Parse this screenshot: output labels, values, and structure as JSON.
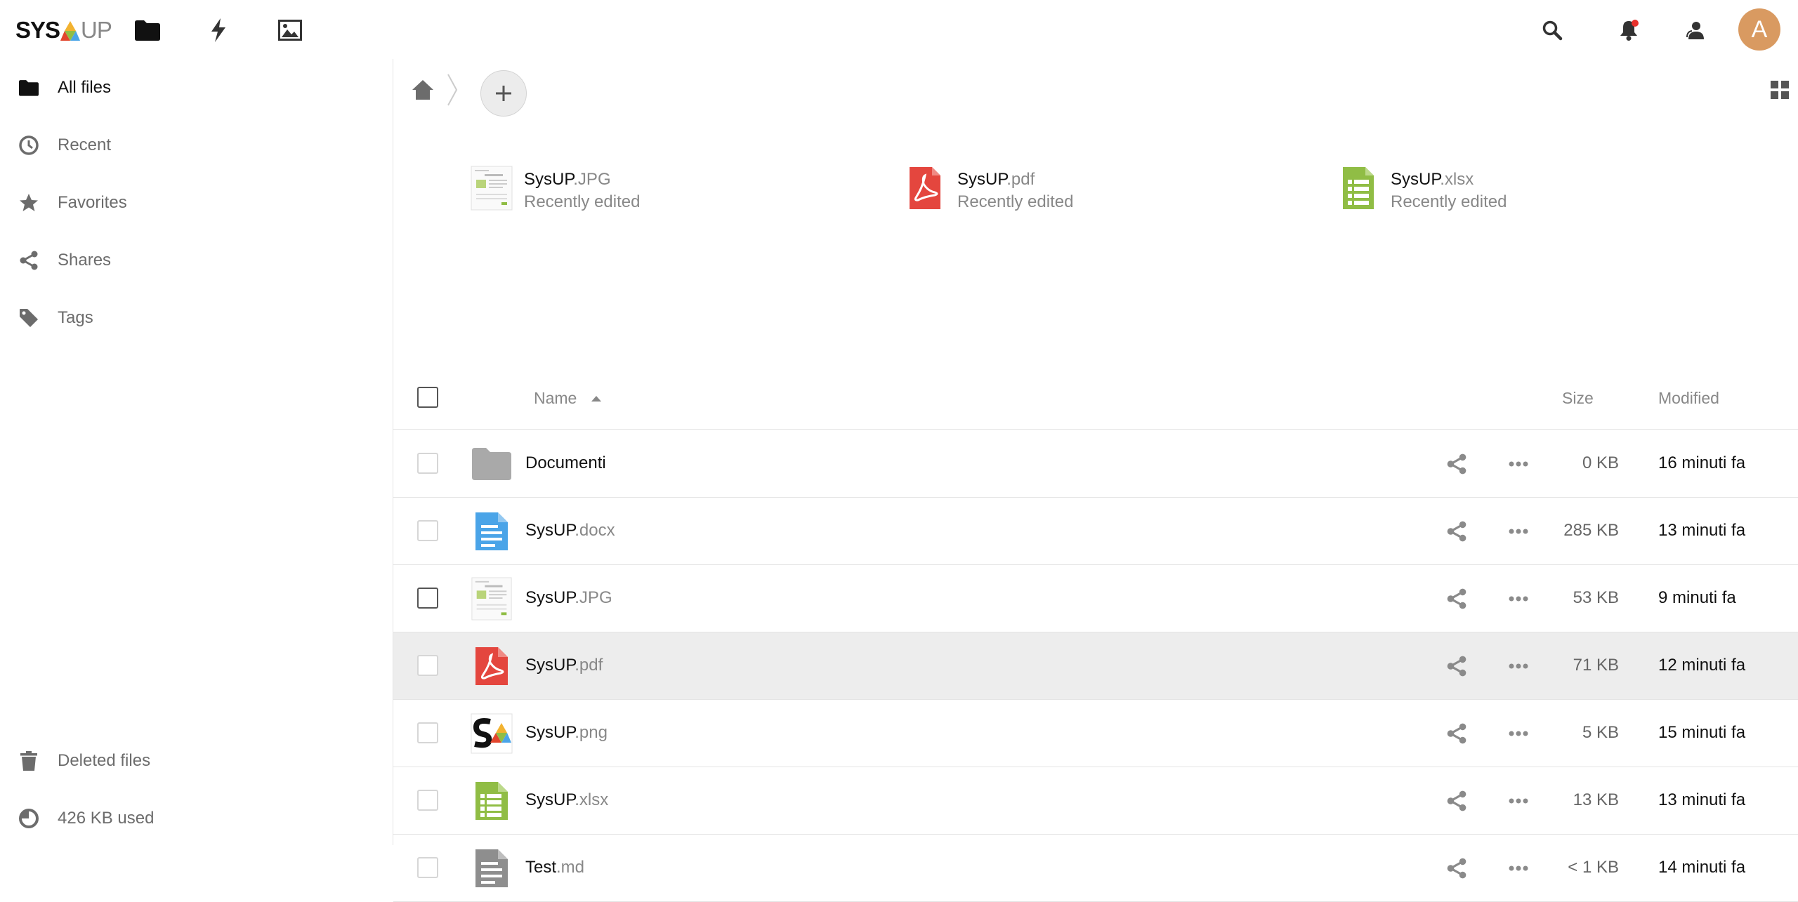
{
  "header": {
    "logo_left": "SYS",
    "logo_right": "UP",
    "apps": [
      {
        "name": "files",
        "icon": "folder-icon"
      },
      {
        "name": "activity",
        "icon": "lightning-icon"
      },
      {
        "name": "gallery",
        "icon": "image-icon"
      }
    ],
    "avatar_letter": "A",
    "notification_dot_color": "#e9322d"
  },
  "sidebar": {
    "items": [
      {
        "label": "All files",
        "icon": "folder-icon",
        "active": true
      },
      {
        "label": "Recent",
        "icon": "clock-icon"
      },
      {
        "label": "Favorites",
        "icon": "star-icon"
      },
      {
        "label": "Shares",
        "icon": "share-icon"
      },
      {
        "label": "Tags",
        "icon": "tag-icon"
      }
    ],
    "bottom": [
      {
        "label": "Deleted files",
        "icon": "trash-icon"
      },
      {
        "label": "426 KB used",
        "icon": "pie-chart-icon"
      }
    ]
  },
  "recent": [
    {
      "base": "SysUP",
      "ext": ".JPG",
      "sub": "Recently edited",
      "type": "jpg"
    },
    {
      "base": "SysUP",
      "ext": ".pdf",
      "sub": "Recently edited",
      "type": "pdf"
    },
    {
      "base": "SysUP",
      "ext": ".xlsx",
      "sub": "Recently edited",
      "type": "xlsx"
    }
  ],
  "columns": {
    "name": "Name",
    "size": "Size",
    "modified": "Modified"
  },
  "files": [
    {
      "base": "Documenti",
      "ext": "",
      "size": "0 KB",
      "modified": "16 minuti fa",
      "type": "folder"
    },
    {
      "base": "SysUP",
      "ext": ".docx",
      "size": "285 KB",
      "modified": "13 minuti fa",
      "type": "docx"
    },
    {
      "base": "SysUP",
      "ext": ".JPG",
      "size": "53 KB",
      "modified": "9 minuti fa",
      "type": "jpg"
    },
    {
      "base": "SysUP",
      "ext": ".pdf",
      "size": "71 KB",
      "modified": "12 minuti fa",
      "type": "pdf",
      "highlighted": true
    },
    {
      "base": "SysUP",
      "ext": ".png",
      "size": "5 KB",
      "modified": "15 minuti fa",
      "type": "png"
    },
    {
      "base": "SysUP",
      "ext": ".xlsx",
      "size": "13 KB",
      "modified": "13 minuti fa",
      "type": "xlsx"
    },
    {
      "base": "Test",
      "ext": ".md",
      "size": "< 1 KB",
      "modified": "14 minuti fa",
      "type": "md"
    }
  ],
  "colors": {
    "pdf": "#e4463e",
    "docx": "#4aa4e8",
    "xlsx": "#90bd45",
    "folder": "#a9a9a9",
    "md": "#8e8e8e"
  }
}
